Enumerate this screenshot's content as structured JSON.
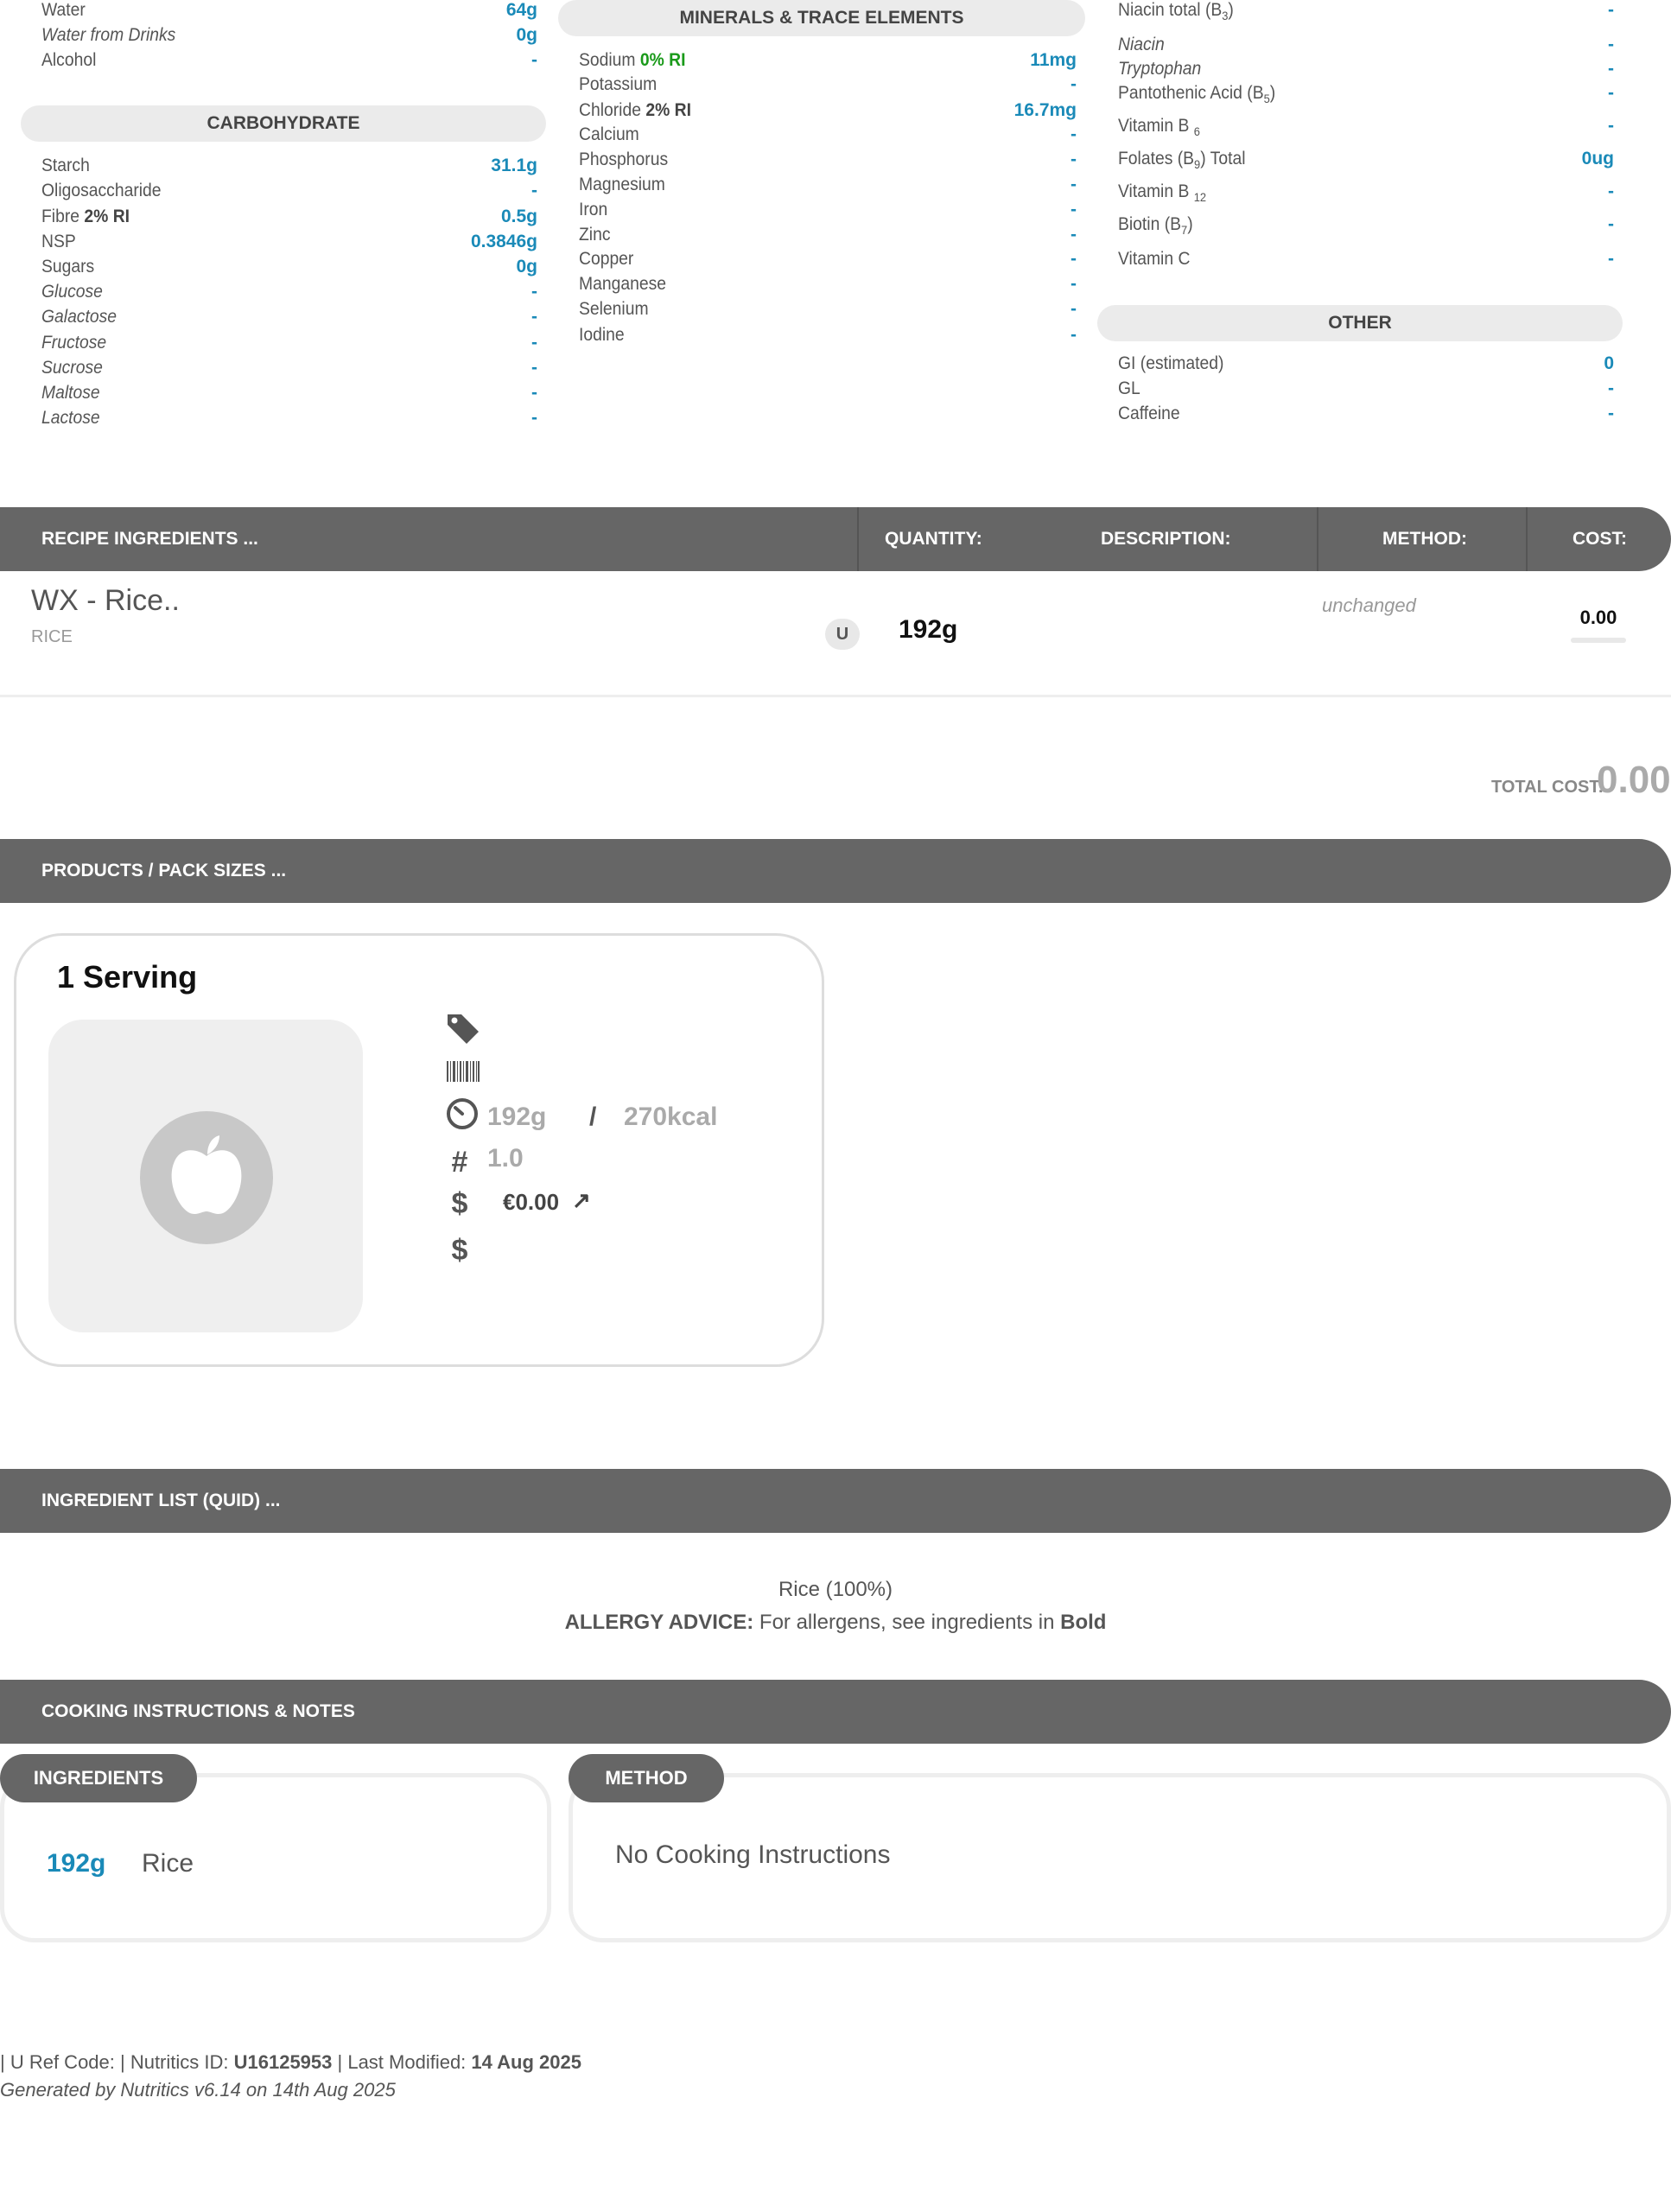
{
  "col1": {
    "rows": [
      {
        "label": "Water",
        "value": "64g",
        "italic": false
      },
      {
        "label": "Water from Drinks",
        "value": "0g",
        "italic": true
      },
      {
        "label": "Alcohol",
        "value": "-",
        "italic": false
      }
    ],
    "carb_header": "CARBOHYDRATE",
    "carb_rows": [
      {
        "label": "Starch",
        "value": "31.1g",
        "italic": false
      },
      {
        "label": "Oligosaccharide",
        "value": "-",
        "italic": false
      },
      {
        "label": "Fibre",
        "ri": "2% RI",
        "value": "0.5g",
        "italic": false
      },
      {
        "label": "NSP",
        "value": "0.3846g",
        "italic": false
      },
      {
        "label": "Sugars",
        "value": "0g",
        "italic": false
      },
      {
        "label": "Glucose",
        "value": "-",
        "italic": true
      },
      {
        "label": "Galactose",
        "value": "-",
        "italic": true
      },
      {
        "label": "Fructose",
        "value": "-",
        "italic": true
      },
      {
        "label": "Sucrose",
        "value": "-",
        "italic": true
      },
      {
        "label": "Maltose",
        "value": "-",
        "italic": true
      },
      {
        "label": "Lactose",
        "value": "-",
        "italic": true
      }
    ]
  },
  "col2": {
    "header": "MINERALS & TRACE ELEMENTS",
    "rows": [
      {
        "label": "Sodium",
        "ri": "0% RI",
        "value": "11mg"
      },
      {
        "label": "Potassium",
        "value": "-"
      },
      {
        "label": "Chloride",
        "ri": "2% RI",
        "value": "16.7mg"
      },
      {
        "label": "Calcium",
        "value": "-"
      },
      {
        "label": "Phosphorus",
        "value": "-"
      },
      {
        "label": "Magnesium",
        "value": "-"
      },
      {
        "label": "Iron",
        "value": "-"
      },
      {
        "label": "Zinc",
        "value": "-"
      },
      {
        "label": "Copper",
        "value": "-"
      },
      {
        "label": "Manganese",
        "value": "-"
      },
      {
        "label": "Selenium",
        "value": "-"
      },
      {
        "label": "Iodine",
        "value": "-"
      }
    ]
  },
  "col3": {
    "rows": [
      {
        "label": "Niacin total (B",
        "sub": "3",
        "tail": ")",
        "value": "-",
        "italic": false
      },
      {
        "label": "Niacin",
        "value": "-",
        "italic": true
      },
      {
        "label": "Tryptophan",
        "value": "-",
        "italic": true
      },
      {
        "label": "Pantothenic Acid (B",
        "sub": "5",
        "tail": ")",
        "value": "-",
        "italic": false
      },
      {
        "label": "Vitamin B ",
        "sub": "6",
        "tail": "",
        "value": "-",
        "italic": false
      },
      {
        "label": "Folates (B",
        "sub": "9",
        "tail": ") Total",
        "value": "0ug",
        "italic": false
      },
      {
        "label": "Vitamin B ",
        "sub": "12",
        "tail": "",
        "value": "-",
        "italic": false
      },
      {
        "label": "Biotin (B",
        "sub": "7",
        "tail": ")",
        "value": "-",
        "italic": false
      },
      {
        "label": "Vitamin C",
        "value": "-",
        "italic": false
      }
    ],
    "other_header": "OTHER",
    "other_rows": [
      {
        "label": "GI (estimated)",
        "value": "0"
      },
      {
        "label": "GL",
        "value": "-"
      },
      {
        "label": "Caffeine",
        "value": "-"
      }
    ]
  },
  "recipe_bar": {
    "title": "RECIPE INGREDIENTS ...",
    "quantity": "QUANTITY:",
    "description": "DESCRIPTION:",
    "method": "METHOD:",
    "cost": "COST:"
  },
  "ingredient": {
    "name": "WX - Rice..",
    "category": "RICE",
    "unit_badge": "U",
    "quantity": "192g",
    "method": "unchanged",
    "cost": "0.00"
  },
  "total_cost": {
    "label": "TOTAL COST:",
    "value": "0.00"
  },
  "products_bar": {
    "title": "PRODUCTS / PACK SIZES ..."
  },
  "product_card": {
    "title": "1 Serving",
    "weight": "192g",
    "slash": "/",
    "energy": "270kcal",
    "count": "1.0",
    "price": "€0.00",
    "price_arrow": "↗"
  },
  "quid_bar": {
    "title": "INGREDIENT LIST (QUID) ..."
  },
  "quid": {
    "text": "Rice (100%)",
    "allergy_label": "ALLERGY ADVICE:",
    "allergy_text": " For allergens, see ingredients in ",
    "allergy_bold": "Bold"
  },
  "cooking_bar": {
    "title": "COOKING INSTRUCTIONS & NOTES"
  },
  "cooking": {
    "ingredients_tab": "INGREDIENTS",
    "method_tab": "METHOD",
    "ing_qty": "192g",
    "ing_name": "Rice",
    "method_text": "No Cooking Instructions"
  },
  "footer": {
    "pre": " |  U Ref Code:   |  Nutritics ID: ",
    "id": "U16125953",
    "mid": "  |  Last Modified: ",
    "date": "14 Aug 2025",
    "generated": "Generated by Nutritics v6.14 on 14th Aug 2025"
  }
}
